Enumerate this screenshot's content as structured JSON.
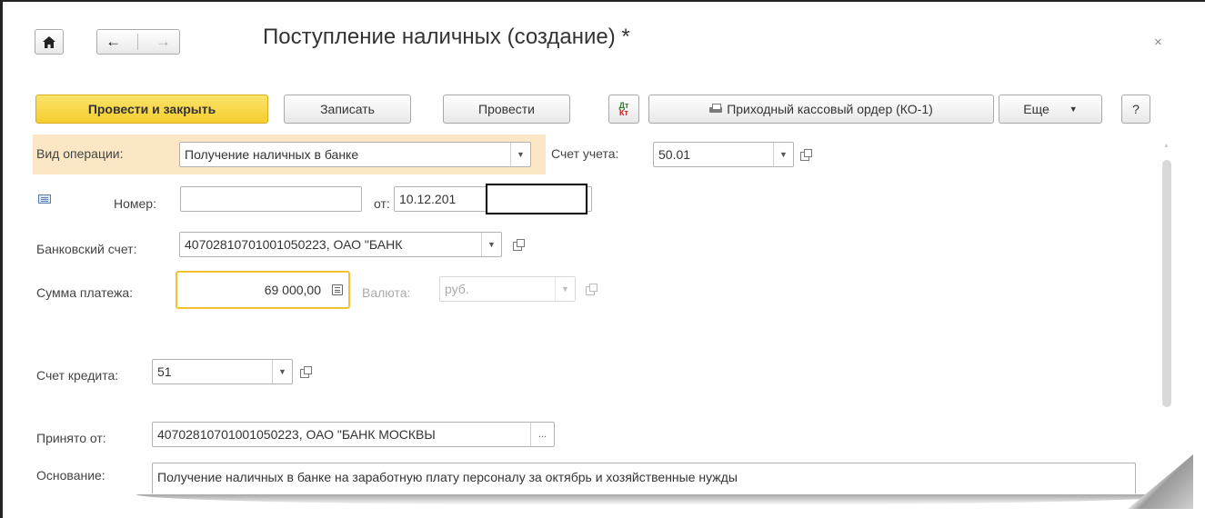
{
  "window": {
    "title": "Поступление наличных (создание) *",
    "close_glyph": "×"
  },
  "nav": {
    "home_icon": "home-icon",
    "back_glyph": "←",
    "forward_glyph": "→"
  },
  "toolbar": {
    "post_and_close": "Провести и закрыть",
    "save": "Записать",
    "post": "Провести",
    "dtkt_top": "Дт",
    "dtkt_bottom": "Кт",
    "print_report": "Приходный кассовый ордер (КО-1)",
    "more": "Еще",
    "help": "?"
  },
  "form": {
    "operation_type_label": "Вид операции:",
    "operation_type_value": "Получение наличных в банке",
    "account_label": "Счет учета:",
    "account_value": "50.01",
    "number_label": "Номер:",
    "number_value": "",
    "date_label": "от:",
    "date_value": "10.12.201",
    "bank_account_label": "Банковский счет:",
    "bank_account_value": "40702810701001050223, ОАО \"БАНК",
    "amount_label": "Сумма платежа:",
    "amount_value": "69 000,00",
    "currency_label": "Валюта:",
    "currency_value": "руб.",
    "credit_account_label": "Счет кредита:",
    "credit_account_value": "51",
    "received_from_label": "Принято от:",
    "received_from_value": "40702810701001050223, ОАО \"БАНК МОСКВЫ",
    "ellipsis": "...",
    "basis_label": "Основание:",
    "basis_value": "Получение наличных в банке на заработную плату персоналу за октябрь и хозяйственные нужды"
  },
  "colors": {
    "primary_button": "#f5cd2e",
    "highlight_row": "#fbe7c6",
    "focus_border": "#f2c230"
  }
}
